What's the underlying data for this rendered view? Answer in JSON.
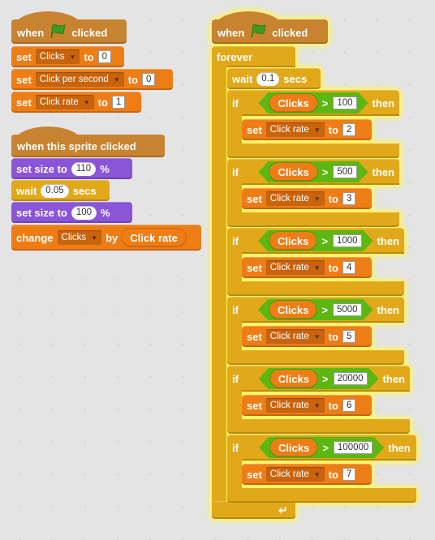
{
  "script1": {
    "hat": {
      "when": "when",
      "icon": "green-flag-icon",
      "clicked": "clicked"
    },
    "blocks": [
      {
        "kw": "set",
        "var": "Clicks",
        "to": "to",
        "value": "0"
      },
      {
        "kw": "set",
        "var": "Click per second",
        "to": "to",
        "value": "0"
      },
      {
        "kw": "set",
        "var": "Click rate",
        "to": "to",
        "value": "1"
      }
    ]
  },
  "script2": {
    "hat": "when this sprite clicked",
    "set_size_1": {
      "label": "set size to",
      "value": "110",
      "unit": "%"
    },
    "wait": {
      "label": "wait",
      "value": "0.05",
      "unit": "secs"
    },
    "set_size_2": {
      "label": "set size to",
      "value": "100",
      "unit": "%"
    },
    "change": {
      "kw": "change",
      "var": "Clicks",
      "by": "by",
      "reporter": "Click rate"
    }
  },
  "script3": {
    "hat": {
      "when": "when",
      "icon": "green-flag-icon",
      "clicked": "clicked"
    },
    "forever": "forever",
    "wait": {
      "label": "wait",
      "value": "0.1",
      "unit": "secs"
    },
    "ifs": [
      {
        "if": "if",
        "reporter": "Clicks",
        "op": ">",
        "threshold": "100",
        "then": "then",
        "set": "set",
        "var": "Click rate",
        "to": "to",
        "value": "2"
      },
      {
        "if": "if",
        "reporter": "Clicks",
        "op": ">",
        "threshold": "500",
        "then": "then",
        "set": "set",
        "var": "Click rate",
        "to": "to",
        "value": "3"
      },
      {
        "if": "if",
        "reporter": "Clicks",
        "op": ">",
        "threshold": "1000",
        "then": "then",
        "set": "set",
        "var": "Click rate",
        "to": "to",
        "value": "4"
      },
      {
        "if": "if",
        "reporter": "Clicks",
        "op": ">",
        "threshold": "5000",
        "then": "then",
        "set": "set",
        "var": "Click rate",
        "to": "to",
        "value": "5"
      },
      {
        "if": "if",
        "reporter": "Clicks",
        "op": ">",
        "threshold": "20000",
        "then": "then",
        "set": "set",
        "var": "Click rate",
        "to": "to",
        "value": "6"
      },
      {
        "if": "if",
        "reporter": "Clicks",
        "op": ">",
        "threshold": "100000",
        "then": "then",
        "set": "set",
        "var": "Click rate",
        "to": "to",
        "value": "7"
      }
    ],
    "loop_icon": "loop-arrow-icon"
  },
  "colors": {
    "events": "#c88330",
    "data": "#ee7d16",
    "looks": "#8a55d7",
    "control": "#e1a91a",
    "operators": "#5cb712",
    "flag": "#3f9b1e"
  }
}
